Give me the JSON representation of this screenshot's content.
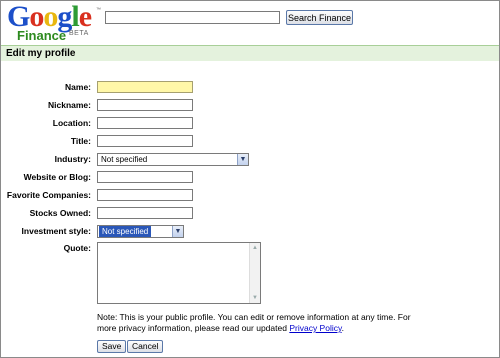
{
  "header": {
    "logo": {
      "wordmark": "Google",
      "trademark": "™",
      "product": "Finance",
      "beta": "BETA"
    },
    "search": {
      "value": "",
      "placeholder": "",
      "button_label": "Search Finance"
    }
  },
  "page": {
    "title": "Edit my profile"
  },
  "form": {
    "name": {
      "label": "Name:",
      "value": ""
    },
    "nickname": {
      "label": "Nickname:",
      "value": ""
    },
    "location": {
      "label": "Location:",
      "value": ""
    },
    "title": {
      "label": "Title:",
      "value": ""
    },
    "industry": {
      "label": "Industry:",
      "selected": "Not specified"
    },
    "website": {
      "label": "Website or Blog:",
      "value": ""
    },
    "favorite_companies": {
      "label": "Favorite Companies:",
      "value": ""
    },
    "stocks_owned": {
      "label": "Stocks Owned:",
      "value": ""
    },
    "investment_style": {
      "label": "Investment style:",
      "selected": "Not specified"
    },
    "quote": {
      "label": "Quote:",
      "value": ""
    }
  },
  "note": {
    "text": "Note: This is your public profile. You can edit or remove information at any time. For more privacy information, please read our updated",
    "link": "Privacy Policy",
    "suffix": "."
  },
  "actions": {
    "save_label": "Save",
    "cancel_label": "Cancel"
  },
  "colors": {
    "header_bar_bg": "#e4f2dd",
    "highlight_field": "#fff7a8",
    "link": "#0000cc",
    "selection": "#2a57b8"
  }
}
